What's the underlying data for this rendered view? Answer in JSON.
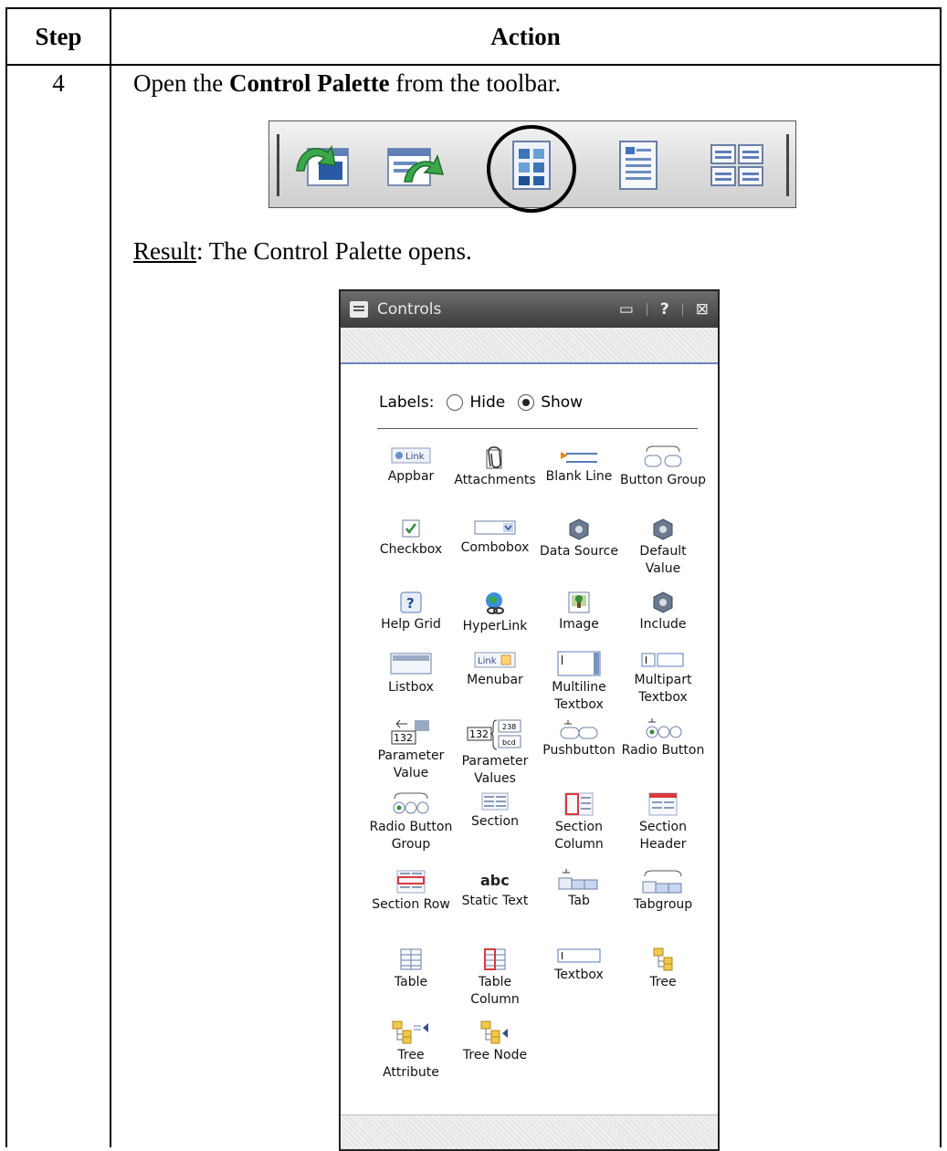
{
  "table": {
    "header_step": "Step",
    "header_action": "Action",
    "step_number": "4",
    "instruction_pre": "Open the ",
    "instruction_bold": "Control Palette",
    "instruction_post": " from the toolbar.",
    "result_label": "Result",
    "result_text": ": The Control Palette opens."
  },
  "toolbar": {
    "icons": [
      "import-arrow-icon",
      "export-arrow-icon",
      "control-palette-icon",
      "properties-page-icon",
      "layout-grid-icon"
    ],
    "highlighted": "control-palette-icon"
  },
  "palette": {
    "title": "Controls",
    "controls_glyphs": {
      "dock": "▭",
      "help": "?",
      "close": "⊠"
    },
    "labels_prefix": "Labels:",
    "option_hide": "Hide",
    "option_show": "Show",
    "selected_option": "Show",
    "items": [
      {
        "label": "Appbar",
        "icon": "appbar-icon"
      },
      {
        "label": "Attachments",
        "icon": "attachments-icon"
      },
      {
        "label": "Blank Line",
        "icon": "blank-line-icon"
      },
      {
        "label": "Button Group",
        "icon": "button-group-icon"
      },
      {
        "label": "Checkbox",
        "icon": "checkbox-icon"
      },
      {
        "label": "Combobox",
        "icon": "combobox-icon"
      },
      {
        "label": "Data Source",
        "icon": "data-source-icon"
      },
      {
        "label": "Default Value",
        "icon": "default-value-icon"
      },
      {
        "label": "Help Grid",
        "icon": "help-grid-icon"
      },
      {
        "label": "HyperLink",
        "icon": "hyperlink-icon"
      },
      {
        "label": "Image",
        "icon": "image-icon"
      },
      {
        "label": "Include",
        "icon": "include-icon"
      },
      {
        "label": "Listbox",
        "icon": "listbox-icon"
      },
      {
        "label": "Menubar",
        "icon": "menubar-icon"
      },
      {
        "label": "Multiline Textbox",
        "icon": "multiline-textbox-icon"
      },
      {
        "label": "Multipart Textbox",
        "icon": "multipart-textbox-icon"
      },
      {
        "label": "Parameter Value",
        "icon": "parameter-value-icon"
      },
      {
        "label": "Parameter Values",
        "icon": "parameter-values-icon"
      },
      {
        "label": "Pushbutton",
        "icon": "pushbutton-icon"
      },
      {
        "label": "Radio Button",
        "icon": "radio-button-icon"
      },
      {
        "label": "Radio Button Group",
        "icon": "radio-button-group-icon"
      },
      {
        "label": "Section",
        "icon": "section-icon"
      },
      {
        "label": "Section Column",
        "icon": "section-column-icon"
      },
      {
        "label": "Section Header",
        "icon": "section-header-icon"
      },
      {
        "label": "Section Row",
        "icon": "section-row-icon"
      },
      {
        "label": "Static Text",
        "icon": "static-text-icon"
      },
      {
        "label": "Tab",
        "icon": "tab-icon"
      },
      {
        "label": "Tabgroup",
        "icon": "tabgroup-icon"
      },
      {
        "label": "Table",
        "icon": "table-icon"
      },
      {
        "label": "Table Column",
        "icon": "table-column-icon"
      },
      {
        "label": "Textbox",
        "icon": "textbox-icon"
      },
      {
        "label": "Tree",
        "icon": "tree-icon"
      },
      {
        "label": "Tree Attribute",
        "icon": "tree-attribute-icon"
      },
      {
        "label": "Tree Node",
        "icon": "tree-node-icon"
      }
    ],
    "icon_texts": {
      "appbar": "Link",
      "menubar": "Link",
      "parameter_value": "132",
      "parameter_values_a": "132",
      "parameter_values_b": "238",
      "parameter_values_c": "bcd",
      "static_text": "abc"
    }
  }
}
